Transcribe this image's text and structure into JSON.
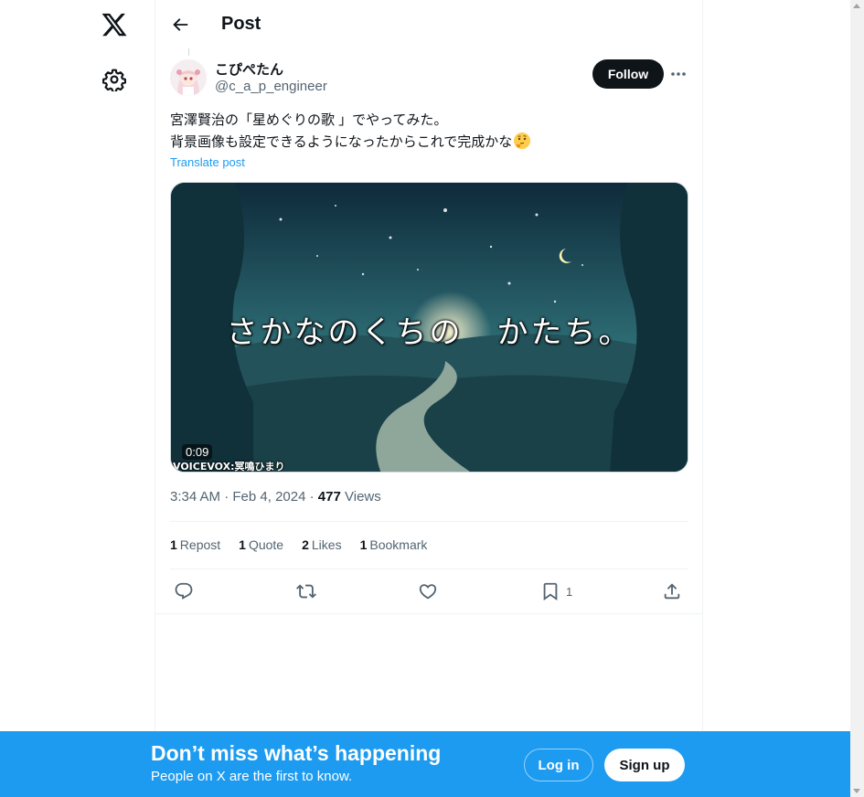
{
  "header": {
    "title": "Post"
  },
  "post": {
    "author": {
      "name": "こぴぺたん",
      "handle": "@c_a_p_engineer"
    },
    "follow_label": "Follow",
    "text_lines": [
      "宮澤賢治の「星めぐりの歌 」でやってみた。",
      "背景画像も設定できるようになったからこれで完成かな"
    ],
    "emoji": "thinking-face",
    "translate_label": "Translate post",
    "media": {
      "caption": "さかなのくちの　かたち。",
      "duration": "0:09",
      "credit": "VOICEVOX:冥鳴ひまり"
    },
    "time": "3:34 AM",
    "date": "Feb 4, 2024",
    "views_count": "477",
    "views_label": "Views",
    "stats": {
      "reposts_count": "1",
      "reposts_label": "Repost",
      "quotes_count": "1",
      "quotes_label": "Quote",
      "likes_count": "2",
      "likes_label": "Likes",
      "bookmarks_count": "1",
      "bookmarks_label": "Bookmark"
    },
    "actions": {
      "bookmark_count": "1"
    }
  },
  "bottom_bar": {
    "title": "Don’t miss what’s happening",
    "subtitle": "People on X are the first to know.",
    "login_label": "Log in",
    "signup_label": "Sign up"
  },
  "colors": {
    "accent": "#1d9bf0",
    "text": "#0f1419",
    "muted": "#536471",
    "border": "#eff3f4"
  }
}
